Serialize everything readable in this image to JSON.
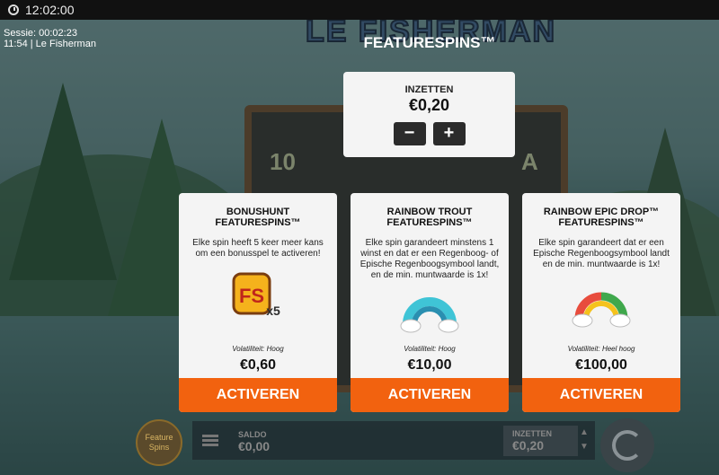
{
  "status": {
    "time": "12:02:00"
  },
  "session": {
    "line1": "Sessie: 00:02:23",
    "line2": "11:54  |  Le Fisherman"
  },
  "game": {
    "logo": "LE FISHERMAN"
  },
  "header": {
    "title": "FEATURESPINS™"
  },
  "bet": {
    "label": "INZETTEN",
    "value": "€0,20",
    "minus": "−",
    "plus": "+"
  },
  "cards": [
    {
      "title1": "BONUSHUNT",
      "title2": "FEATURESPINS™",
      "desc": "Elke spin heeft 5 keer meer kans om een bonusspel te activeren!",
      "volatility": "Volatiliteit: Hoog",
      "price": "€0,60",
      "button": "ACTIVEREN",
      "icon": "fs-x5-icon"
    },
    {
      "title1": "RAINBOW TROUT",
      "title2": "FEATURESPINS™",
      "desc": "Elke spin garandeert minstens 1 winst en dat er een Regenboog- of Epische Regenboogsymbool landt, en de min. muntwaarde is 1x!",
      "volatility": "Volatiliteit: Hoog",
      "price": "€10,00",
      "button": "ACTIVEREN",
      "icon": "rainbow-icon"
    },
    {
      "title1": "RAINBOW EPIC DROP™",
      "title2": "FEATURESPINS™",
      "desc": "Elke spin garandeert dat er een Epische Regenboogsymbool landt en de min. muntwaarde is 1x!",
      "volatility": "Volatiliteit: Heel hoog",
      "price": "€100,00",
      "button": "ACTIVEREN",
      "icon": "epic-rainbow-icon"
    }
  ],
  "bottom": {
    "feature_btn": "Feature Spins",
    "saldo_label": "SALDO",
    "saldo_value": "€0,00",
    "inzetten_label": "INZETTEN",
    "inzetten_value": "€0,20"
  },
  "colors": {
    "accent": "#f2620f",
    "card_bg": "#f4f4f4",
    "button_dark": "#2b2b2b"
  }
}
